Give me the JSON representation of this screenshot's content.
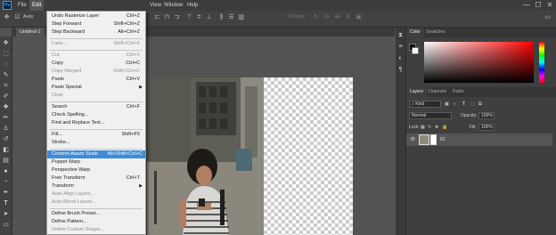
{
  "app": {
    "logo": "Ps"
  },
  "menubar": {
    "items": [
      "File",
      "Edit",
      "View",
      "Window",
      "Help"
    ],
    "active": "Edit",
    "window_controls": [
      "—",
      "☐",
      "✕"
    ]
  },
  "options_bar": {
    "auto_label": "Auto",
    "mode_3d": "3D Mode:"
  },
  "document": {
    "tab_label": "Untitled-1"
  },
  "edit_menu": {
    "items": [
      {
        "label": "Undo Rasterize Layer",
        "shortcut": "Ctrl+Z",
        "disabled": false
      },
      {
        "label": "Step Forward",
        "shortcut": "Shift+Ctrl+Z",
        "disabled": false
      },
      {
        "label": "Step Backward",
        "shortcut": "Alt+Ctrl+Z",
        "disabled": false
      },
      {
        "label": "Fade...",
        "shortcut": "Shift+Ctrl+F",
        "disabled": true
      },
      {
        "label": "Cut",
        "shortcut": "Ctrl+X",
        "disabled": true
      },
      {
        "label": "Copy",
        "shortcut": "Ctrl+C",
        "disabled": false
      },
      {
        "label": "Copy Merged",
        "shortcut": "Shift+Ctrl+C",
        "disabled": true
      },
      {
        "label": "Paste",
        "shortcut": "Ctrl+V",
        "disabled": false
      },
      {
        "label": "Paste Special",
        "shortcut": "",
        "disabled": false
      },
      {
        "label": "Clear",
        "shortcut": "",
        "disabled": true
      },
      {
        "label": "Search",
        "shortcut": "Ctrl+F",
        "disabled": false
      },
      {
        "label": "Check Spelling...",
        "shortcut": "",
        "disabled": false
      },
      {
        "label": "Find and Replace Text...",
        "shortcut": "",
        "disabled": false
      },
      {
        "label": "Fill...",
        "shortcut": "Shift+F5",
        "disabled": false
      },
      {
        "label": "Stroke...",
        "shortcut": "",
        "disabled": false
      },
      {
        "label": "Content-Aware Scale",
        "shortcut": "Alt+Shift+Ctrl+C",
        "disabled": false
      },
      {
        "label": "Puppet Warp",
        "shortcut": "",
        "disabled": false
      },
      {
        "label": "Perspective Warp",
        "shortcut": "",
        "disabled": false
      },
      {
        "label": "Free Transform",
        "shortcut": "Ctrl+T",
        "disabled": false
      },
      {
        "label": "Transform",
        "shortcut": "",
        "disabled": false
      },
      {
        "label": "Auto-Align Layers...",
        "shortcut": "",
        "disabled": true
      },
      {
        "label": "Auto-Blend Layers...",
        "shortcut": "",
        "disabled": true
      },
      {
        "label": "Define Brush Preset...",
        "shortcut": "",
        "disabled": false
      },
      {
        "label": "Define Pattern...",
        "shortcut": "",
        "disabled": false
      },
      {
        "label": "Define Custom Shape...",
        "shortcut": "",
        "disabled": true
      }
    ]
  },
  "color_panel": {
    "tabs": [
      "Color",
      "Swatches"
    ]
  },
  "layers_panel": {
    "tabs": [
      "Layers",
      "Channels",
      "Paths"
    ],
    "kind_filter": "Kind",
    "blend_mode": "Normal",
    "opacity_label": "Opacity:",
    "opacity_value": "100%",
    "lock_label": "Lock:",
    "fill_label": "Fill:",
    "fill_value": "100%",
    "layer_name": "01"
  },
  "colors": {
    "highlight": "#3f8cd4",
    "menu_bg": "#f0f0f0",
    "ui_dark": "#424242"
  }
}
